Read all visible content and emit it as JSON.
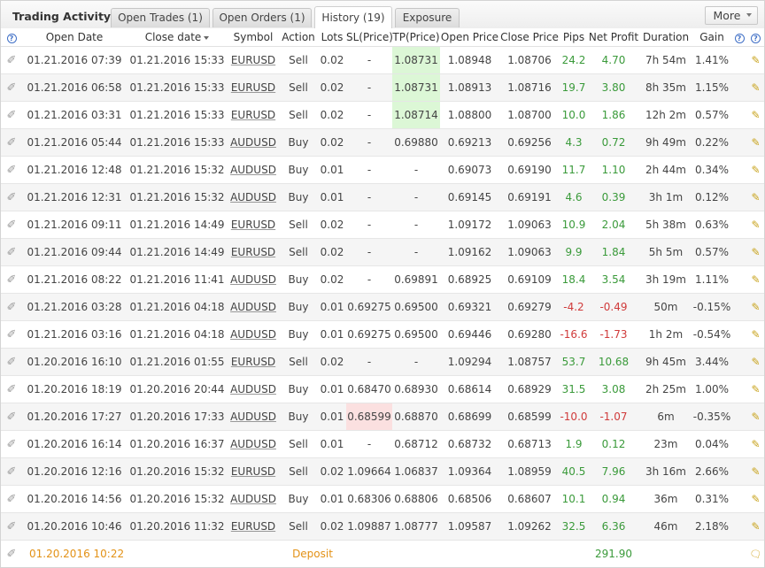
{
  "header": {
    "title": "Trading Activity",
    "tabs": [
      "Open Trades (1)",
      "Open Orders (1)",
      "History (19)",
      "Exposure"
    ],
    "more_label": "More"
  },
  "columns": [
    "Open Date",
    "Close date",
    "Symbol",
    "Action",
    "Lots",
    "SL(Price)",
    "TP(Price)",
    "Open Price",
    "Close Price",
    "Pips",
    "Net Profit",
    "Duration",
    "Gain"
  ],
  "colors": {
    "positive": "#3a9a3a",
    "negative": "#d03b3b",
    "deposit": "#e39217",
    "tp_highlight": "#dcf7d6",
    "sl_highlight": "#fbe0e0"
  },
  "icons": {
    "row_left": "paperclip-icon",
    "row_right": "pencil-icon",
    "deposit_right": "comment-icon",
    "header": "help-icon"
  },
  "rows": [
    {
      "open": "01.21.2016 07:39",
      "close": "01.21.2016 15:33",
      "symbol": "EURUSD",
      "action": "Sell",
      "lots": "0.02",
      "sl": "-",
      "tp": "1.08731",
      "open_price": "1.08948",
      "close_price": "1.08706",
      "pips": "24.2",
      "profit": "4.70",
      "duration": "7h 54m",
      "gain": "1.41%"
    },
    {
      "open": "01.21.2016 06:58",
      "close": "01.21.2016 15:33",
      "symbol": "EURUSD",
      "action": "Sell",
      "lots": "0.02",
      "sl": "-",
      "tp": "1.08731",
      "open_price": "1.08913",
      "close_price": "1.08716",
      "pips": "19.7",
      "profit": "3.80",
      "duration": "8h 35m",
      "gain": "1.15%"
    },
    {
      "open": "01.21.2016 03:31",
      "close": "01.21.2016 15:33",
      "symbol": "EURUSD",
      "action": "Sell",
      "lots": "0.02",
      "sl": "-",
      "tp": "1.08714",
      "open_price": "1.08800",
      "close_price": "1.08700",
      "pips": "10.0",
      "profit": "1.86",
      "duration": "12h 2m",
      "gain": "0.57%"
    },
    {
      "open": "01.21.2016 05:44",
      "close": "01.21.2016 15:33",
      "symbol": "AUDUSD",
      "action": "Buy",
      "lots": "0.02",
      "sl": "-",
      "tp": "0.69880",
      "open_price": "0.69213",
      "close_price": "0.69256",
      "pips": "4.3",
      "profit": "0.72",
      "duration": "9h 49m",
      "gain": "0.22%"
    },
    {
      "open": "01.21.2016 12:48",
      "close": "01.21.2016 15:32",
      "symbol": "AUDUSD",
      "action": "Buy",
      "lots": "0.01",
      "sl": "-",
      "tp": "-",
      "open_price": "0.69073",
      "close_price": "0.69190",
      "pips": "11.7",
      "profit": "1.10",
      "duration": "2h 44m",
      "gain": "0.34%"
    },
    {
      "open": "01.21.2016 12:31",
      "close": "01.21.2016 15:32",
      "symbol": "AUDUSD",
      "action": "Buy",
      "lots": "0.01",
      "sl": "-",
      "tp": "-",
      "open_price": "0.69145",
      "close_price": "0.69191",
      "pips": "4.6",
      "profit": "0.39",
      "duration": "3h 1m",
      "gain": "0.12%"
    },
    {
      "open": "01.21.2016 09:11",
      "close": "01.21.2016 14:49",
      "symbol": "EURUSD",
      "action": "Sell",
      "lots": "0.02",
      "sl": "-",
      "tp": "-",
      "open_price": "1.09172",
      "close_price": "1.09063",
      "pips": "10.9",
      "profit": "2.04",
      "duration": "5h 38m",
      "gain": "0.63%"
    },
    {
      "open": "01.21.2016 09:44",
      "close": "01.21.2016 14:49",
      "symbol": "EURUSD",
      "action": "Sell",
      "lots": "0.02",
      "sl": "-",
      "tp": "-",
      "open_price": "1.09162",
      "close_price": "1.09063",
      "pips": "9.9",
      "profit": "1.84",
      "duration": "5h 5m",
      "gain": "0.57%"
    },
    {
      "open": "01.21.2016 08:22",
      "close": "01.21.2016 11:41",
      "symbol": "AUDUSD",
      "action": "Buy",
      "lots": "0.02",
      "sl": "-",
      "tp": "0.69891",
      "open_price": "0.68925",
      "close_price": "0.69109",
      "pips": "18.4",
      "profit": "3.54",
      "duration": "3h 19m",
      "gain": "1.11%"
    },
    {
      "open": "01.21.2016 03:28",
      "close": "01.21.2016 04:18",
      "symbol": "AUDUSD",
      "action": "Buy",
      "lots": "0.01",
      "sl": "0.69275",
      "tp": "0.69500",
      "open_price": "0.69321",
      "close_price": "0.69279",
      "pips": "-4.2",
      "profit": "-0.49",
      "duration": "50m",
      "gain": "-0.15%"
    },
    {
      "open": "01.21.2016 03:16",
      "close": "01.21.2016 04:18",
      "symbol": "AUDUSD",
      "action": "Buy",
      "lots": "0.01",
      "sl": "0.69275",
      "tp": "0.69500",
      "open_price": "0.69446",
      "close_price": "0.69280",
      "pips": "-16.6",
      "profit": "-1.73",
      "duration": "1h 2m",
      "gain": "-0.54%"
    },
    {
      "open": "01.20.2016 16:10",
      "close": "01.21.2016 01:55",
      "symbol": "EURUSD",
      "action": "Sell",
      "lots": "0.02",
      "sl": "-",
      "tp": "-",
      "open_price": "1.09294",
      "close_price": "1.08757",
      "pips": "53.7",
      "profit": "10.68",
      "duration": "9h 45m",
      "gain": "3.44%"
    },
    {
      "open": "01.20.2016 18:19",
      "close": "01.20.2016 20:44",
      "symbol": "AUDUSD",
      "action": "Buy",
      "lots": "0.01",
      "sl": "0.68470",
      "tp": "0.68930",
      "open_price": "0.68614",
      "close_price": "0.68929",
      "pips": "31.5",
      "profit": "3.08",
      "duration": "2h 25m",
      "gain": "1.00%"
    },
    {
      "open": "01.20.2016 17:27",
      "close": "01.20.2016 17:33",
      "symbol": "AUDUSD",
      "action": "Buy",
      "lots": "0.01",
      "sl": "0.68599",
      "tp": "0.68870",
      "open_price": "0.68699",
      "close_price": "0.68599",
      "pips": "-10.0",
      "profit": "-1.07",
      "duration": "6m",
      "gain": "-0.35%"
    },
    {
      "open": "01.20.2016 16:14",
      "close": "01.20.2016 16:37",
      "symbol": "AUDUSD",
      "action": "Sell",
      "lots": "0.01",
      "sl": "-",
      "tp": "0.68712",
      "open_price": "0.68732",
      "close_price": "0.68713",
      "pips": "1.9",
      "profit": "0.12",
      "duration": "23m",
      "gain": "0.04%"
    },
    {
      "open": "01.20.2016 12:16",
      "close": "01.20.2016 15:32",
      "symbol": "EURUSD",
      "action": "Sell",
      "lots": "0.02",
      "sl": "1.09664",
      "tp": "1.06837",
      "open_price": "1.09364",
      "close_price": "1.08959",
      "pips": "40.5",
      "profit": "7.96",
      "duration": "3h 16m",
      "gain": "2.66%"
    },
    {
      "open": "01.20.2016 14:56",
      "close": "01.20.2016 15:32",
      "symbol": "AUDUSD",
      "action": "Buy",
      "lots": "0.01",
      "sl": "0.68306",
      "tp": "0.68806",
      "open_price": "0.68506",
      "close_price": "0.68607",
      "pips": "10.1",
      "profit": "0.94",
      "duration": "36m",
      "gain": "0.31%"
    },
    {
      "open": "01.20.2016 10:46",
      "close": "01.20.2016 11:32",
      "symbol": "EURUSD",
      "action": "Sell",
      "lots": "0.02",
      "sl": "1.09887",
      "tp": "1.08777",
      "open_price": "1.09587",
      "close_price": "1.09262",
      "pips": "32.5",
      "profit": "6.36",
      "duration": "46m",
      "gain": "2.18%"
    }
  ],
  "deposit": {
    "date": "01.20.2016 10:22",
    "label": "Deposit",
    "amount": "291.90"
  }
}
